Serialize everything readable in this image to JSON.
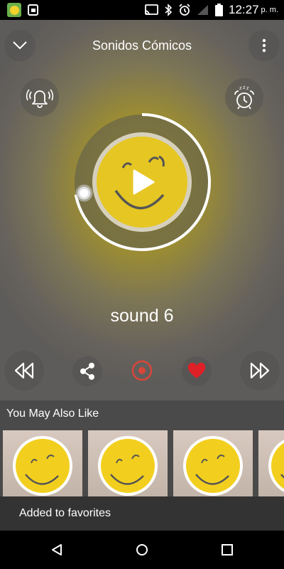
{
  "status_bar": {
    "time": "12:27",
    "period": "p. m."
  },
  "header": {
    "title": "Sonidos Cómicos"
  },
  "player": {
    "sound_name": "sound 6",
    "progress_fraction": 0.72
  },
  "recommendations": {
    "title": "You May Also Like",
    "card_count": 4
  },
  "snackbar": {
    "message": "Added to favorites"
  },
  "colors": {
    "accent_yellow": "#e6c623",
    "heart_red": "#e02027",
    "record_red": "#d9453a",
    "section_bg": "#4a4a4a",
    "snackbar_bg": "#333333"
  },
  "icons": {
    "header_left": "chevron-down-icon",
    "header_right": "more-vert-icon",
    "left_side": "bell-ringing-icon",
    "right_side": "alarm-clock-icon",
    "controls": [
      "rewind-icon",
      "share-icon",
      "record-icon",
      "heart-icon",
      "fast-forward-icon"
    ]
  }
}
